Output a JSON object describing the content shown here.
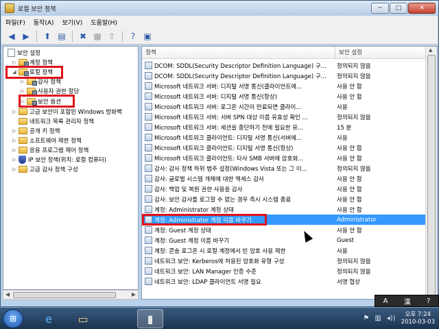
{
  "window": {
    "title": "로컬 보안 정책",
    "min": "─",
    "max": "□",
    "close": "✕"
  },
  "menu": [
    "파일(F)",
    "동작(A)",
    "보기(V)",
    "도움말(H)"
  ],
  "toolbar": [
    {
      "name": "back-icon",
      "glyph": "◀"
    },
    {
      "name": "forward-icon",
      "glyph": "▶"
    },
    {
      "name": "up-folder-icon",
      "glyph": "⬆"
    },
    {
      "name": "show-hide-tree-icon",
      "glyph": "▤"
    },
    {
      "name": "delete-icon",
      "glyph": "✖"
    },
    {
      "name": "properties-icon",
      "glyph": "▦"
    },
    {
      "name": "export-icon",
      "glyph": "⇪"
    },
    {
      "name": "help-icon",
      "glyph": "?"
    },
    {
      "name": "view-icon",
      "glyph": "▣"
    }
  ],
  "tree": [
    {
      "label": "보안 설정",
      "depth": 0,
      "expander": "",
      "icon": "doc"
    },
    {
      "label": "계정 정책",
      "depth": 1,
      "expander": "▷",
      "icon": "folder"
    },
    {
      "label": "로컬 정책",
      "depth": 1,
      "expander": "◢",
      "icon": "folder"
    },
    {
      "label": "감사 정책",
      "depth": 2,
      "expander": "▷",
      "icon": "folder"
    },
    {
      "label": "사용자 권한 할당",
      "depth": 2,
      "expander": "▷",
      "icon": "folder"
    },
    {
      "label": "보안 옵션",
      "depth": 2,
      "expander": "▷",
      "icon": "folder"
    },
    {
      "label": "고급 보안이 포함된 Windows 방화벽",
      "depth": 1,
      "expander": "▷",
      "icon": "folder"
    },
    {
      "label": "네트워크 목록 관리자 정책",
      "depth": 1,
      "expander": "",
      "icon": "folder"
    },
    {
      "label": "공개 키 정책",
      "depth": 1,
      "expander": "▷",
      "icon": "folder"
    },
    {
      "label": "소프트웨어 제한 정책",
      "depth": 1,
      "expander": "▷",
      "icon": "folder"
    },
    {
      "label": "응용 프로그램 제어 정책",
      "depth": 1,
      "expander": "▷",
      "icon": "folder"
    },
    {
      "label": "IP 보안 정책(위치: 로컬 컴퓨터)",
      "depth": 1,
      "expander": "▷",
      "icon": "shield"
    },
    {
      "label": "고급 감사 정책 구성",
      "depth": 1,
      "expander": "▷",
      "icon": "folder"
    }
  ],
  "columns": {
    "policy": "정책",
    "setting": "보안 설정"
  },
  "rows": [
    {
      "name": "DCOM: SDDL(Security Descriptor Definition Language) 구...",
      "value": "정의되지 않음"
    },
    {
      "name": "DCOM: SDDL(Security Descriptor Definition Language) 구...",
      "value": "정의되지 않음"
    },
    {
      "name": "Microsoft 네트워크 서버: 디지털 서명 통신(클라이언트에...",
      "value": "사용 안 함"
    },
    {
      "name": "Microsoft 네트워크 서버: 디지털 서명 통신(항상)",
      "value": "사용 안 함"
    },
    {
      "name": "Microsoft 네트워크 서버: 로그온 시간이 만료되면 클라이...",
      "value": "사용"
    },
    {
      "name": "Microsoft 네트워크 서버: 서버 SPN 대상 이름 유효성 확인 ...",
      "value": "정의되지 않음"
    },
    {
      "name": "Microsoft 네트워크 서버: 세션을 중단하기 전에 필요한 유...",
      "value": "15 분"
    },
    {
      "name": "Microsoft 네트워크 클라이언트: 디지털 서명 통신(서버에...",
      "value": "사용"
    },
    {
      "name": "Microsoft 네트워크 클라이언트: 디지털 서명 통신(항상)",
      "value": "사용 안 함"
    },
    {
      "name": "Microsoft 네트워크 클라이언트: 타사 SMB 서버에 암호화...",
      "value": "사용 안 함"
    },
    {
      "name": "감사: 감사 정책 하위 범주 설정(Windows Vista 또는 그 이...",
      "value": "정의되지 않음"
    },
    {
      "name": "감사: 글로벌 시스템 개체에 대한 액세스 감사",
      "value": "사용 안 함"
    },
    {
      "name": "감사: 백업 및 복원 권한 사용을 감사",
      "value": "사용 안 함"
    },
    {
      "name": "감사: 보안 감사를 로그할 수 없는 경우 즉시 시스템 종료",
      "value": "사용 안 함"
    },
    {
      "name": "계정: Administrator 계정 상태",
      "value": "사용 안 함"
    },
    {
      "name": "계정: Administrator 계정 이름 바꾸기",
      "value": "Administrator"
    },
    {
      "name": "계정: Guest 계정 상태",
      "value": "사용 안 함"
    },
    {
      "name": "계정: Guest 계정 이름 바꾸기",
      "value": "Guest"
    },
    {
      "name": "계정: 콘솔 로그온 시 로컬 계정에서 빈 암호 사용 제한",
      "value": "사용"
    },
    {
      "name": "네트워크 보안: Kerberos에 허용된 암호화 유형 구성",
      "value": "정의되지 않음"
    },
    {
      "name": "네트워크 보안: LAN Manager 인증 수준",
      "value": "정의되지 않음"
    },
    {
      "name": "네트워크 보안: LDAP 클라이언트 서명 필요",
      "value": "서명 협상"
    }
  ],
  "selected_row": 15,
  "ime": {
    "mode": "A",
    "hanja": "漢",
    "help": "?"
  },
  "taskbar": {
    "start": "⊞",
    "ie": "e",
    "explorer": "▭",
    "secpol": "▮"
  },
  "clock": {
    "time": "오후 7:24",
    "date": "2010-03-03"
  },
  "tray": {
    "network": "▥",
    "volume": "◂))",
    "flag": "⚑"
  }
}
